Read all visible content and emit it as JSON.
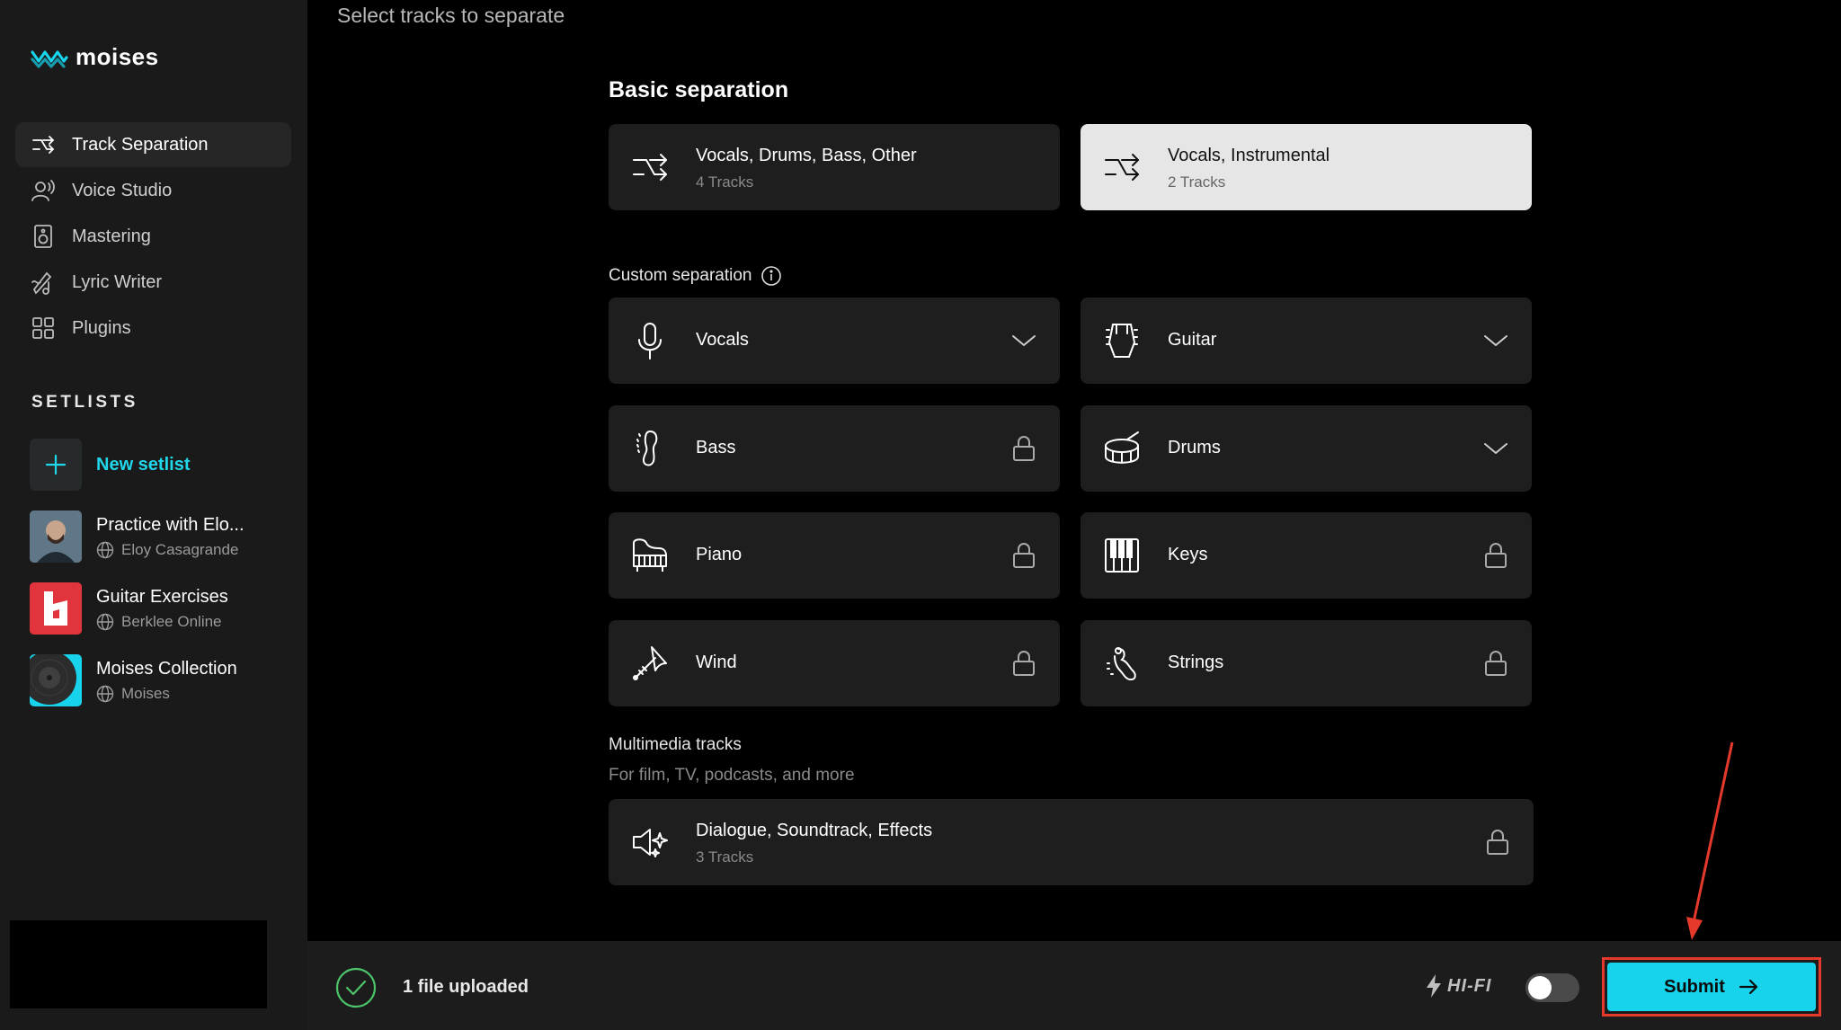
{
  "app": {
    "logo_text": "moises",
    "brand_color": "#17d4ec"
  },
  "sidebar": {
    "nav": [
      {
        "label": "Track Separation",
        "icon": "split-arrows-icon",
        "active": true
      },
      {
        "label": "Voice Studio",
        "icon": "voice-icon",
        "active": false
      },
      {
        "label": "Mastering",
        "icon": "speaker-icon",
        "active": false
      },
      {
        "label": "Lyric Writer",
        "icon": "pen-note-icon",
        "active": false
      },
      {
        "label": "Plugins",
        "icon": "grid-icon",
        "active": false
      }
    ],
    "setlists_heading": "SETLISTS",
    "new_setlist_label": "New setlist",
    "setlists": [
      {
        "title": "Practice with Elo...",
        "owner": "Eloy Casagrande"
      },
      {
        "title": "Guitar Exercises",
        "owner": "Berklee Online"
      },
      {
        "title": "Moises Collection",
        "owner": "Moises"
      }
    ]
  },
  "main": {
    "page_title": "Select tracks to separate",
    "basic_title": "Basic separation",
    "basic": [
      {
        "name": "Vocals, Drums, Bass, Other",
        "tracks": "4 Tracks",
        "selected": false
      },
      {
        "name": "Vocals, Instrumental",
        "tracks": "2 Tracks",
        "selected": true
      }
    ],
    "custom_title": "Custom separation",
    "custom": [
      {
        "name": "Vocals",
        "icon": "microphone-icon",
        "state": "dropdown"
      },
      {
        "name": "Guitar",
        "icon": "guitar-pick-icon",
        "state": "dropdown"
      },
      {
        "name": "Bass",
        "icon": "bass-guitar-icon",
        "state": "locked"
      },
      {
        "name": "Drums",
        "icon": "drum-icon",
        "state": "dropdown"
      },
      {
        "name": "Piano",
        "icon": "grand-piano-icon",
        "state": "locked"
      },
      {
        "name": "Keys",
        "icon": "keyboard-keys-icon",
        "state": "locked"
      },
      {
        "name": "Wind",
        "icon": "trumpet-icon",
        "state": "locked"
      },
      {
        "name": "Strings",
        "icon": "violin-icon",
        "state": "locked"
      }
    ],
    "multimedia_title": "Multimedia tracks",
    "multimedia_desc": "For film, TV, podcasts, and more",
    "multimedia": {
      "name": "Dialogue, Soundtrack, Effects",
      "tracks": "3 Tracks",
      "state": "locked"
    }
  },
  "footer": {
    "upload_status": "1 file uploaded",
    "hifi_label": "HI-FI",
    "hifi_enabled": false,
    "submit_label": "Submit"
  }
}
